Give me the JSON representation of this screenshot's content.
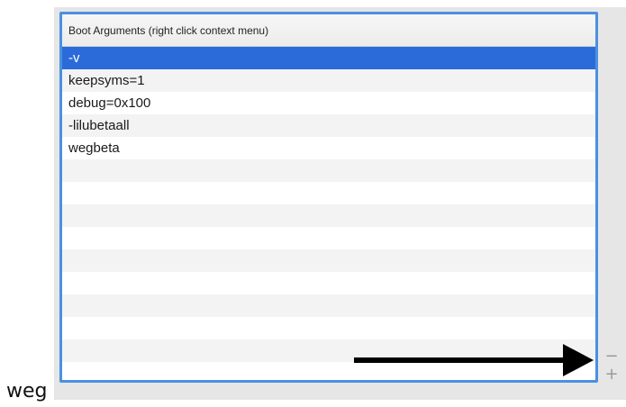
{
  "table": {
    "header": "Boot Arguments (right click context menu)",
    "rows": [
      "-v",
      "keepsyms=1",
      "debug=0x100",
      "-lilubetaall",
      "wegbeta",
      "",
      "",
      "",
      "",
      "",
      "",
      "",
      "",
      ""
    ],
    "selected_index": 0
  },
  "controls": {
    "remove_label": "−",
    "add_label": "+"
  },
  "footer_text": "weg",
  "colors": {
    "selection": "#2b6bd9",
    "focus_border": "#4a90e2",
    "arrow": "#000000"
  },
  "icons": {
    "arrow": "right-arrow-icon"
  }
}
